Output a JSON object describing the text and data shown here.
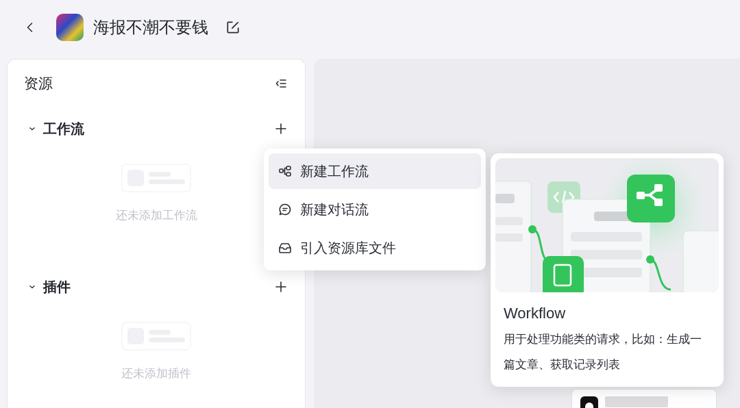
{
  "header": {
    "title": "海报不潮不要钱"
  },
  "sidebar": {
    "title": "资源",
    "sections": [
      {
        "title": "工作流",
        "expanded": true,
        "empty_text": "还未添加工作流"
      },
      {
        "title": "插件",
        "expanded": true,
        "empty_text": "还未添加插件"
      }
    ]
  },
  "add_menu": {
    "items": [
      {
        "kind": "workflow",
        "label": "新建工作流",
        "selected": true
      },
      {
        "kind": "chatflow",
        "label": "新建对话流",
        "selected": false
      },
      {
        "kind": "library",
        "label": "引入资源库文件",
        "selected": false
      }
    ]
  },
  "preview_card": {
    "title": "Workflow",
    "description": "用于处理功能类的请求，比如：生成一篇文章、获取记录列表"
  }
}
